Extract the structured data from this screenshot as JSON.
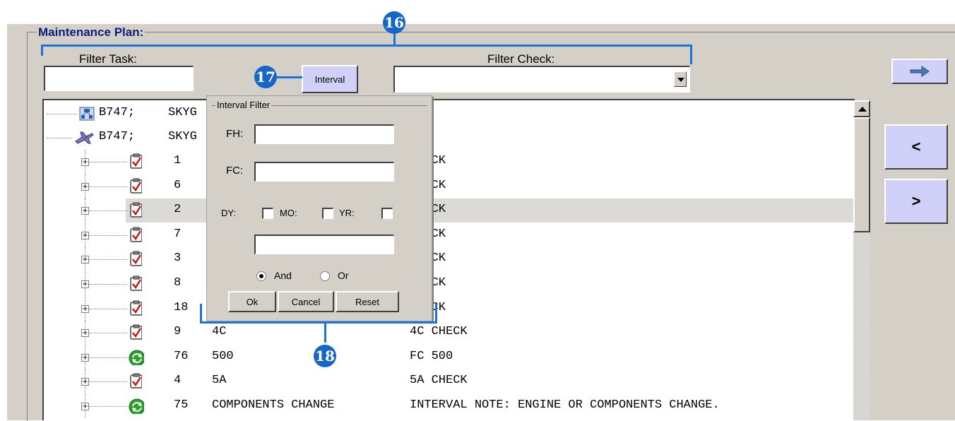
{
  "group_title": "Maintenance Plan:",
  "filter_task": {
    "label": "Filter Task:",
    "value": ""
  },
  "interval_button": "Interval",
  "filter_check": {
    "label": "Filter Check:",
    "value": ""
  },
  "nav_buttons": {
    "forward": "➡",
    "prev": "<",
    "next": ">"
  },
  "tree_header_rows": [
    {
      "icon": "fleet-icon",
      "col1": "B747;",
      "col2": "SKYG"
    },
    {
      "icon": "aircraft-icon",
      "col1": "B747;",
      "col2": "SKYG"
    }
  ],
  "tree_rows": [
    {
      "id": "1",
      "task": "",
      "desc": "CHECK",
      "icon": "checklist-icon"
    },
    {
      "id": "6",
      "task": "",
      "desc": "CHECK",
      "icon": "checklist-icon"
    },
    {
      "id": "2",
      "task": "",
      "desc": "CHECK",
      "icon": "checklist-icon",
      "selected": true
    },
    {
      "id": "7",
      "task": "",
      "desc": "CHECK",
      "icon": "checklist-icon"
    },
    {
      "id": "3",
      "task": "",
      "desc": "CHECK",
      "icon": "checklist-icon"
    },
    {
      "id": "8",
      "task": "",
      "desc": "CHECK",
      "icon": "checklist-icon"
    },
    {
      "id": "18",
      "task": "",
      "desc": "CHECK",
      "icon": "checklist-icon"
    },
    {
      "id": "9",
      "task": "4C",
      "desc": "4C CHECK",
      "icon": "checklist-icon"
    },
    {
      "id": "76",
      "task": "500",
      "desc": "FC 500",
      "icon": "recurring-green-icon"
    },
    {
      "id": "4",
      "task": "5A",
      "desc": "5A CHECK",
      "icon": "checklist-icon"
    },
    {
      "id": "75",
      "task": "COMPONENTS CHANGE",
      "desc": "INTERVAL NOTE: ENGINE OR COMPONENTS CHANGE.",
      "icon": "recurring-green-icon"
    }
  ],
  "interval_dialog": {
    "title": "Interval Filter",
    "fh_label": "FH:",
    "fh_value": "",
    "fc_label": "FC:",
    "fc_value": "",
    "dy_label": "DY:",
    "mo_label": "MO:",
    "yr_label": "YR:",
    "dy_checked": false,
    "mo_checked": false,
    "yr_checked": false,
    "calendar_value": "",
    "and_label": "And",
    "or_label": "Or",
    "logic_selected": "And",
    "ok": "Ok",
    "cancel": "Cancel",
    "reset": "Reset"
  },
  "annotations": {
    "a16": "16",
    "a17": "17",
    "a18": "18"
  },
  "colors": {
    "annotation": "#1466c8",
    "button_lavender": "#d0d0f8",
    "panel": "#d4d0c8"
  }
}
